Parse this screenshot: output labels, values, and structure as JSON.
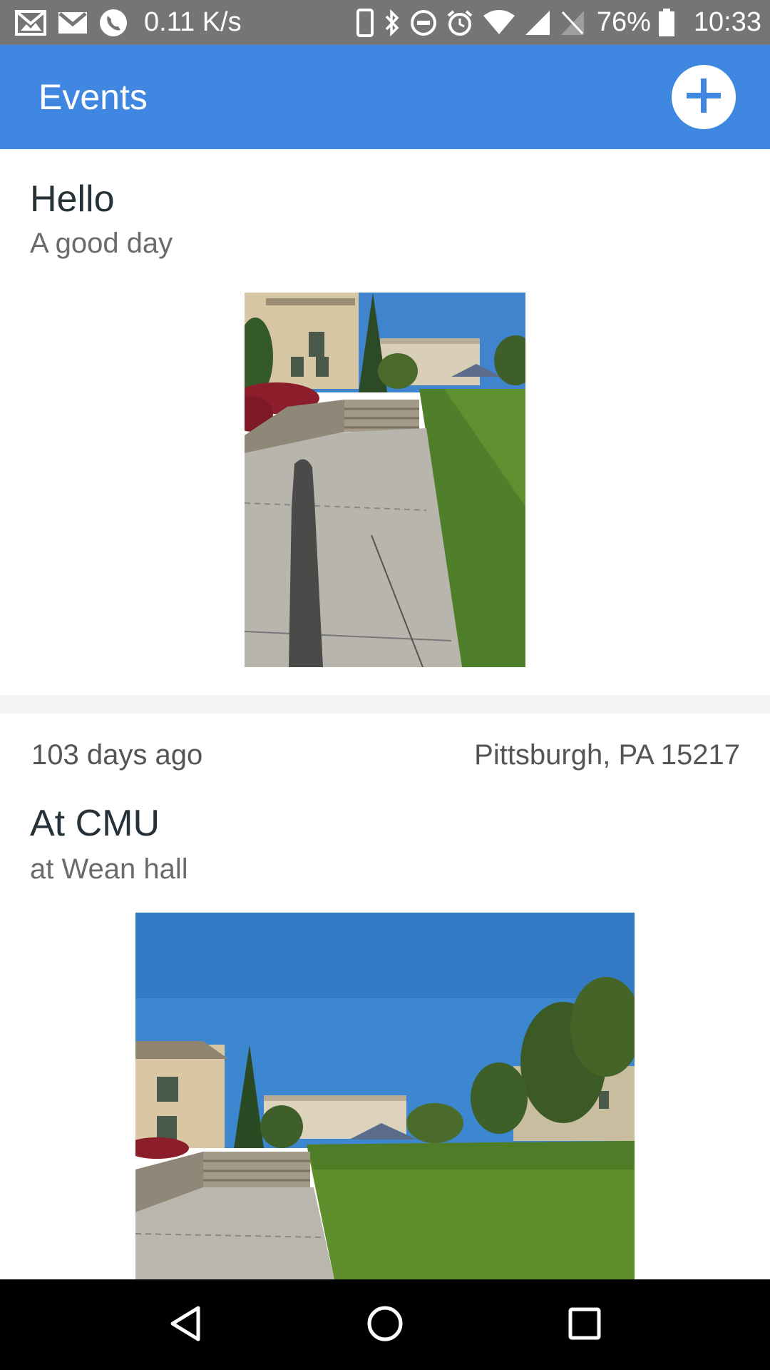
{
  "status_bar": {
    "speed": "0.11 K/s",
    "battery": "76%",
    "time": "10:33",
    "left_icons": [
      "gallery-mail-icon",
      "gmail-icon",
      "phone-icon"
    ],
    "right_icons": [
      "phone-device-icon",
      "bluetooth-icon",
      "dnd-icon",
      "alarm-icon",
      "wifi-icon",
      "signal-icon",
      "no-sim-icon",
      "battery-icon"
    ]
  },
  "app_bar": {
    "title": "Events",
    "add_icon": "plus-icon",
    "color": "#3f87e0"
  },
  "events": [
    {
      "title": "Hello",
      "subtitle": "A good day"
    },
    {
      "time_ago": "103 days ago",
      "location": "Pittsburgh,  PA 15217",
      "title": "At CMU",
      "subtitle": "at Wean hall"
    }
  ],
  "nav_bar": {
    "icons": [
      "back-icon",
      "home-icon",
      "recents-icon"
    ]
  }
}
